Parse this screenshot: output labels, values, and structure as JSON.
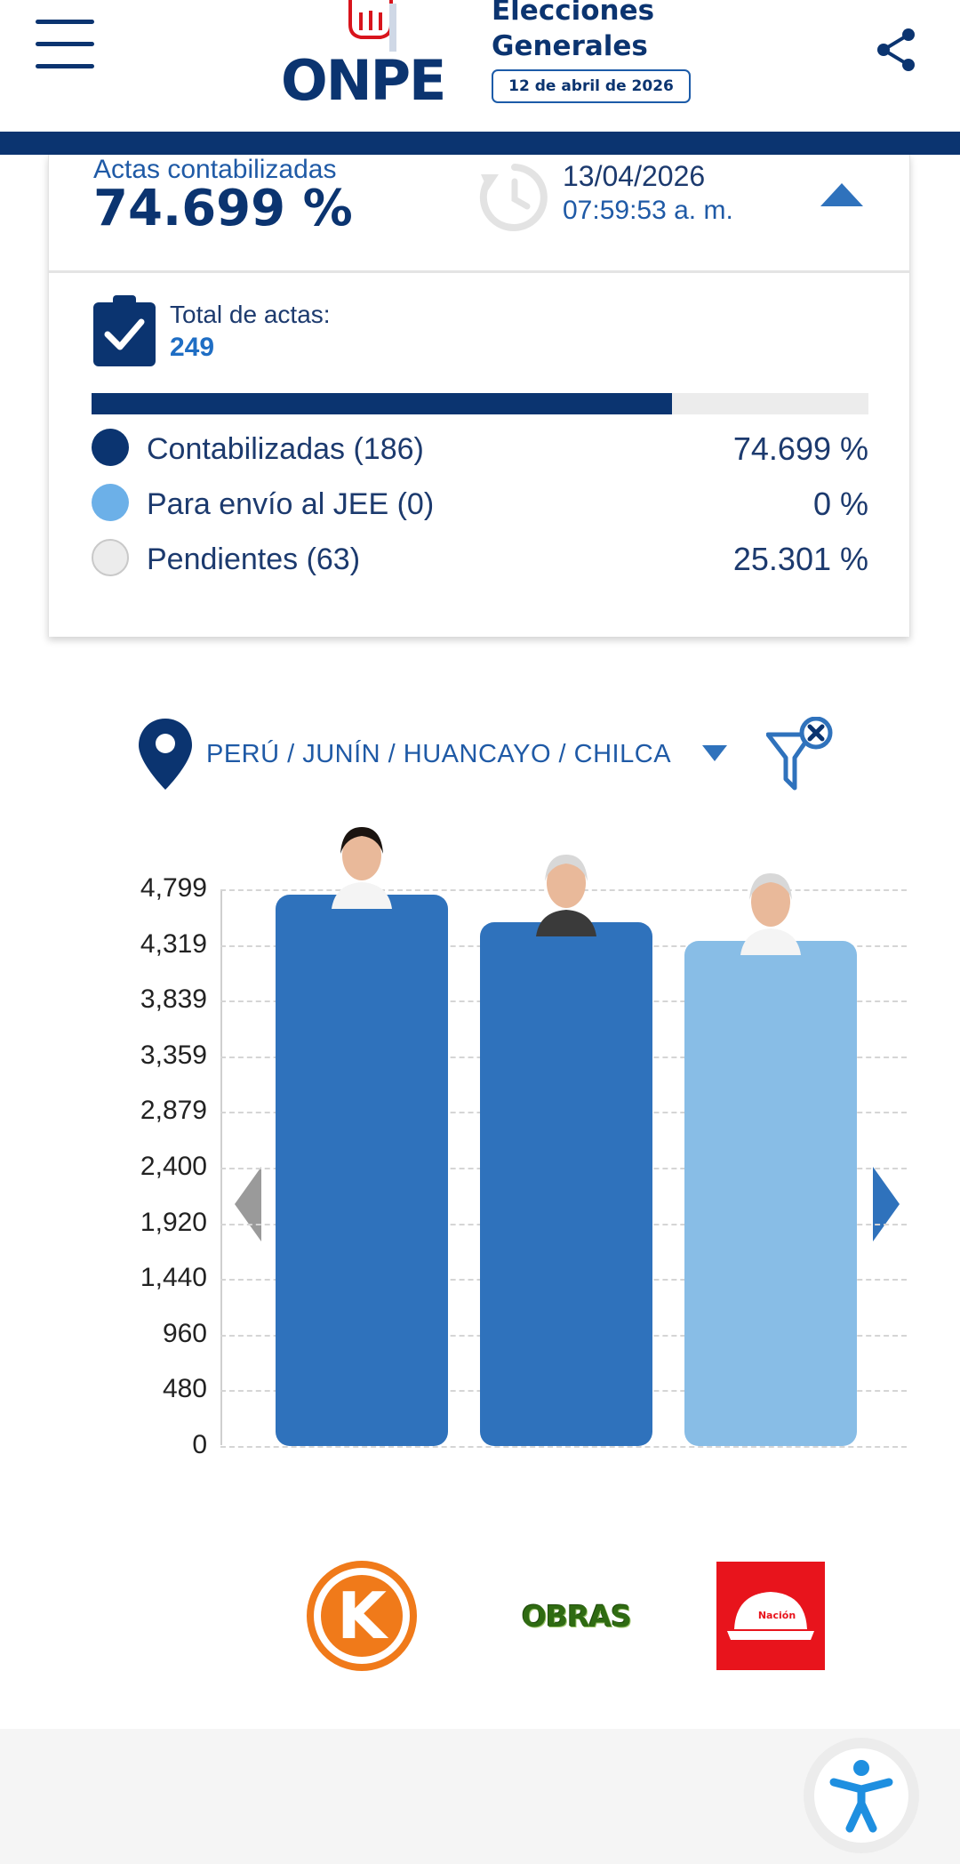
{
  "header": {
    "logo_text": "ONPE",
    "title_line1": "Elecciones",
    "title_line2": "Generales",
    "election_date": "12 de abril de 2026"
  },
  "summary": {
    "actas_label": "Actas contabilizadas",
    "actas_pct": "74.699 %",
    "update_date": "13/04/2026",
    "update_time": "07:59:53 a. m.",
    "total_label": "Total de actas:",
    "total_value": "249",
    "progress_fraction": 0.747,
    "legend": [
      {
        "label": "Contabilizadas (186)",
        "pct": "74.699 %",
        "color": "#0b3470"
      },
      {
        "label": "Para envío al JEE (0)",
        "pct": "0 %",
        "color": "#6cb0e8"
      },
      {
        "label": "Pendientes (63)",
        "pct": "25.301 %",
        "color": "#ececec"
      }
    ]
  },
  "location": {
    "path": "PERÚ / JUNÍN / HUANCAYO / CHILCA"
  },
  "chart_data": {
    "type": "bar",
    "categories": [
      "K",
      "OBRAS",
      "Nación"
    ],
    "values": [
      4799,
      4560,
      4400
    ],
    "colors": [
      "#2f72bc",
      "#2f72bc",
      "#88bde6"
    ],
    "yticks": [
      "4,799",
      "4,319",
      "3,839",
      "3,359",
      "2,879",
      "2,400",
      "1,920",
      "1,440",
      "960",
      "480",
      "0"
    ],
    "ylim": [
      0,
      4799
    ],
    "grid": true
  },
  "parties": [
    {
      "name": "K",
      "logo_text": "K",
      "color": "#f07a1a",
      "icon": "fuerza-popular-logo"
    },
    {
      "name": "OBRAS",
      "logo_text": "OBRAS",
      "color": "#2f6b12",
      "icon": "obras-logo"
    },
    {
      "name": "Nación",
      "logo_text": "Nación",
      "color": "#e8141c",
      "icon": "helmet-logo"
    }
  ]
}
